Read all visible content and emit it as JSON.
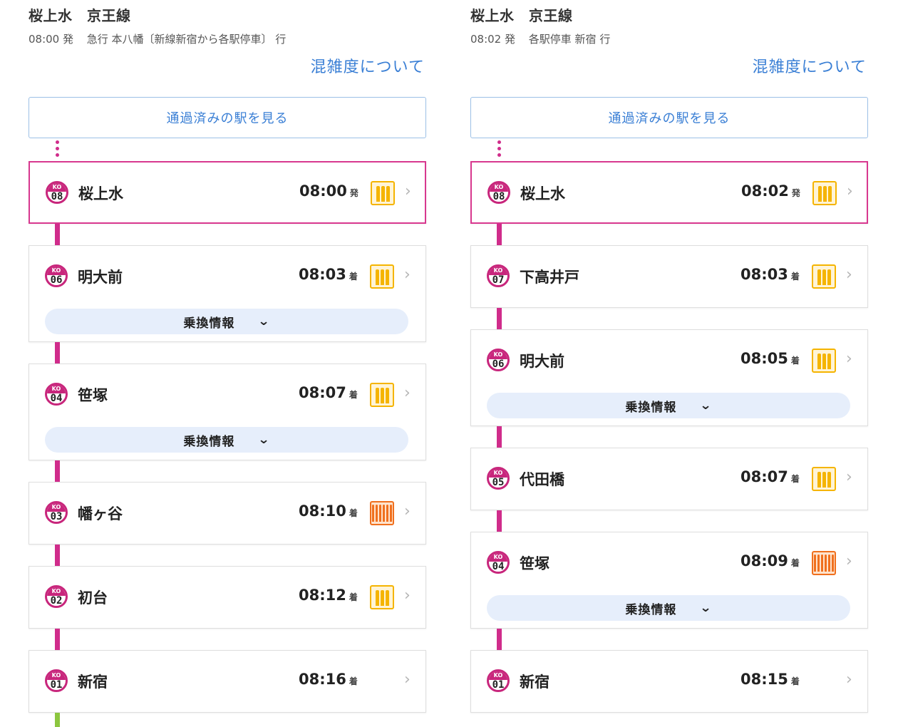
{
  "congestion_label": "混雑度について",
  "passed_label": "通過済みの駅を見る",
  "transfer_label": "乗換情報",
  "colors": {
    "keio_line": "#d02c8b",
    "link": "#3a7fd5",
    "crowd_medium": "#f5b400",
    "crowd_high": "#f0701e"
  },
  "left": {
    "title": "桜上水　京王線",
    "sub_time": "08:00 発",
    "sub_train": "急行 本八幡〔新線新宿から各駅停車〕 行",
    "stations": [
      {
        "code": "KO",
        "num": "08",
        "name": "桜上水",
        "time": "08:00",
        "kind": "発",
        "crowd": "medium",
        "transfer": false
      },
      {
        "code": "KO",
        "num": "06",
        "name": "明大前",
        "time": "08:03",
        "kind": "着",
        "crowd": "medium",
        "transfer": true
      },
      {
        "code": "KO",
        "num": "04",
        "name": "笹塚",
        "time": "08:07",
        "kind": "着",
        "crowd": "medium",
        "transfer": true
      },
      {
        "code": "KO",
        "num": "03",
        "name": "幡ヶ谷",
        "time": "08:10",
        "kind": "着",
        "crowd": "high",
        "transfer": false
      },
      {
        "code": "KO",
        "num": "02",
        "name": "初台",
        "time": "08:12",
        "kind": "着",
        "crowd": "medium",
        "transfer": false
      },
      {
        "code": "KO",
        "num": "01",
        "name": "新宿",
        "time": "08:16",
        "kind": "着",
        "crowd": "none",
        "transfer": false
      }
    ]
  },
  "right": {
    "title": "桜上水　京王線",
    "sub_time": "08:02 発",
    "sub_train": "各駅停車 新宿 行",
    "stations": [
      {
        "code": "KO",
        "num": "08",
        "name": "桜上水",
        "time": "08:02",
        "kind": "発",
        "crowd": "medium",
        "transfer": false
      },
      {
        "code": "KO",
        "num": "07",
        "name": "下高井戸",
        "time": "08:03",
        "kind": "着",
        "crowd": "medium",
        "transfer": false
      },
      {
        "code": "KO",
        "num": "06",
        "name": "明大前",
        "time": "08:05",
        "kind": "着",
        "crowd": "medium",
        "transfer": true
      },
      {
        "code": "KO",
        "num": "05",
        "name": "代田橋",
        "time": "08:07",
        "kind": "着",
        "crowd": "medium",
        "transfer": false
      },
      {
        "code": "KO",
        "num": "04",
        "name": "笹塚",
        "time": "08:09",
        "kind": "着",
        "crowd": "high",
        "transfer": true
      },
      {
        "code": "KO",
        "num": "01",
        "name": "新宿",
        "time": "08:15",
        "kind": "着",
        "crowd": "none",
        "transfer": false
      }
    ]
  }
}
